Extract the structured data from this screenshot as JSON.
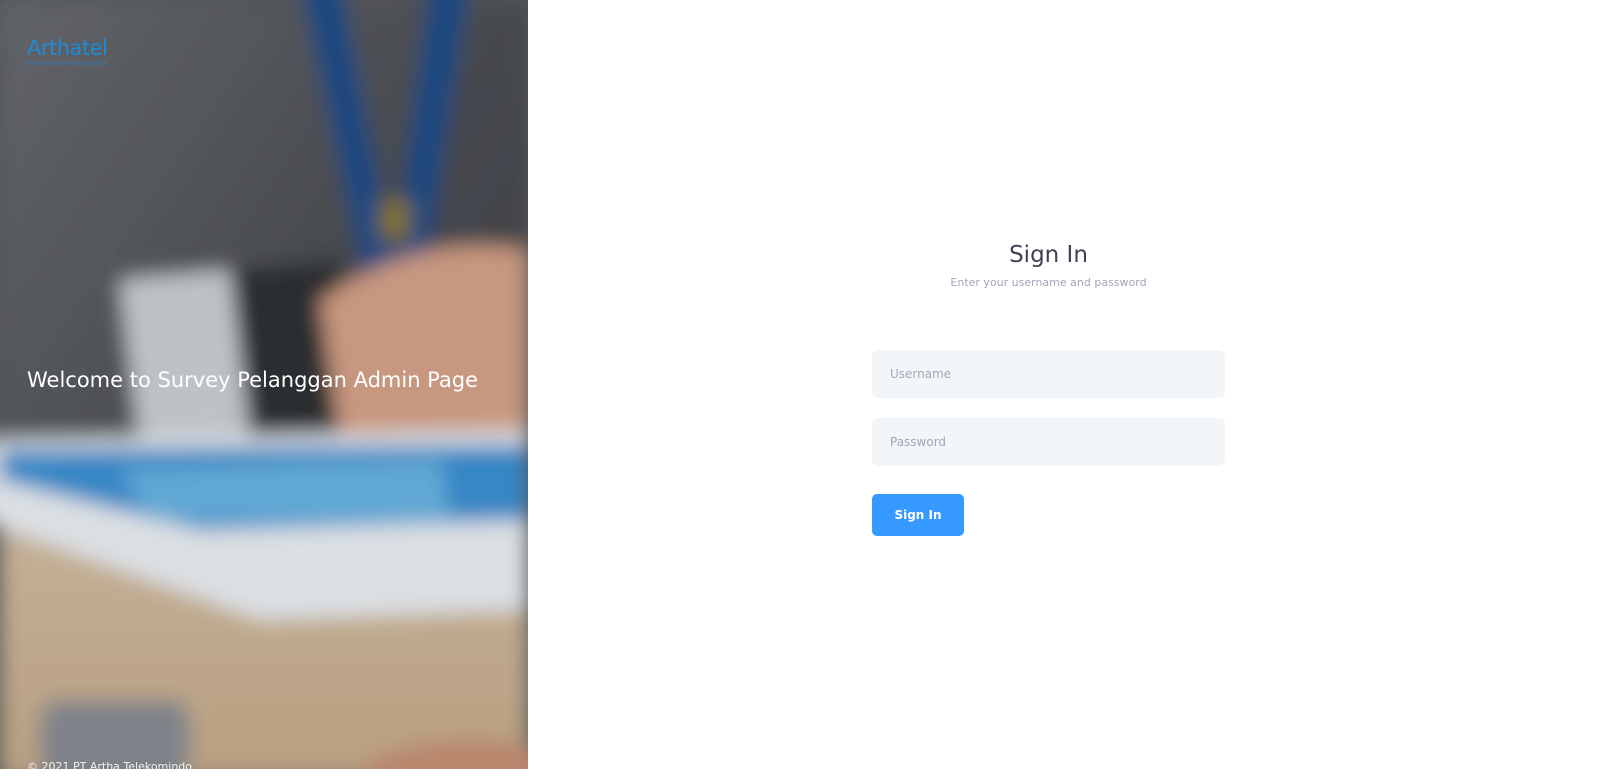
{
  "brand": {
    "name": "Arthatel",
    "tagline": "NETWORK SOLUTIONS SECURED",
    "color": "#1f8ad6"
  },
  "hero": {
    "title": "Welcome to Survey Pelanggan Admin Page",
    "footer": "© 2021 PT Artha Telekomindo"
  },
  "signin": {
    "title": "Sign In",
    "subtitle": "Enter your username and password",
    "username_placeholder": "Username",
    "username_value": "",
    "password_placeholder": "Password",
    "password_value": "",
    "button_label": "Sign In",
    "button_color": "#3699ff"
  }
}
